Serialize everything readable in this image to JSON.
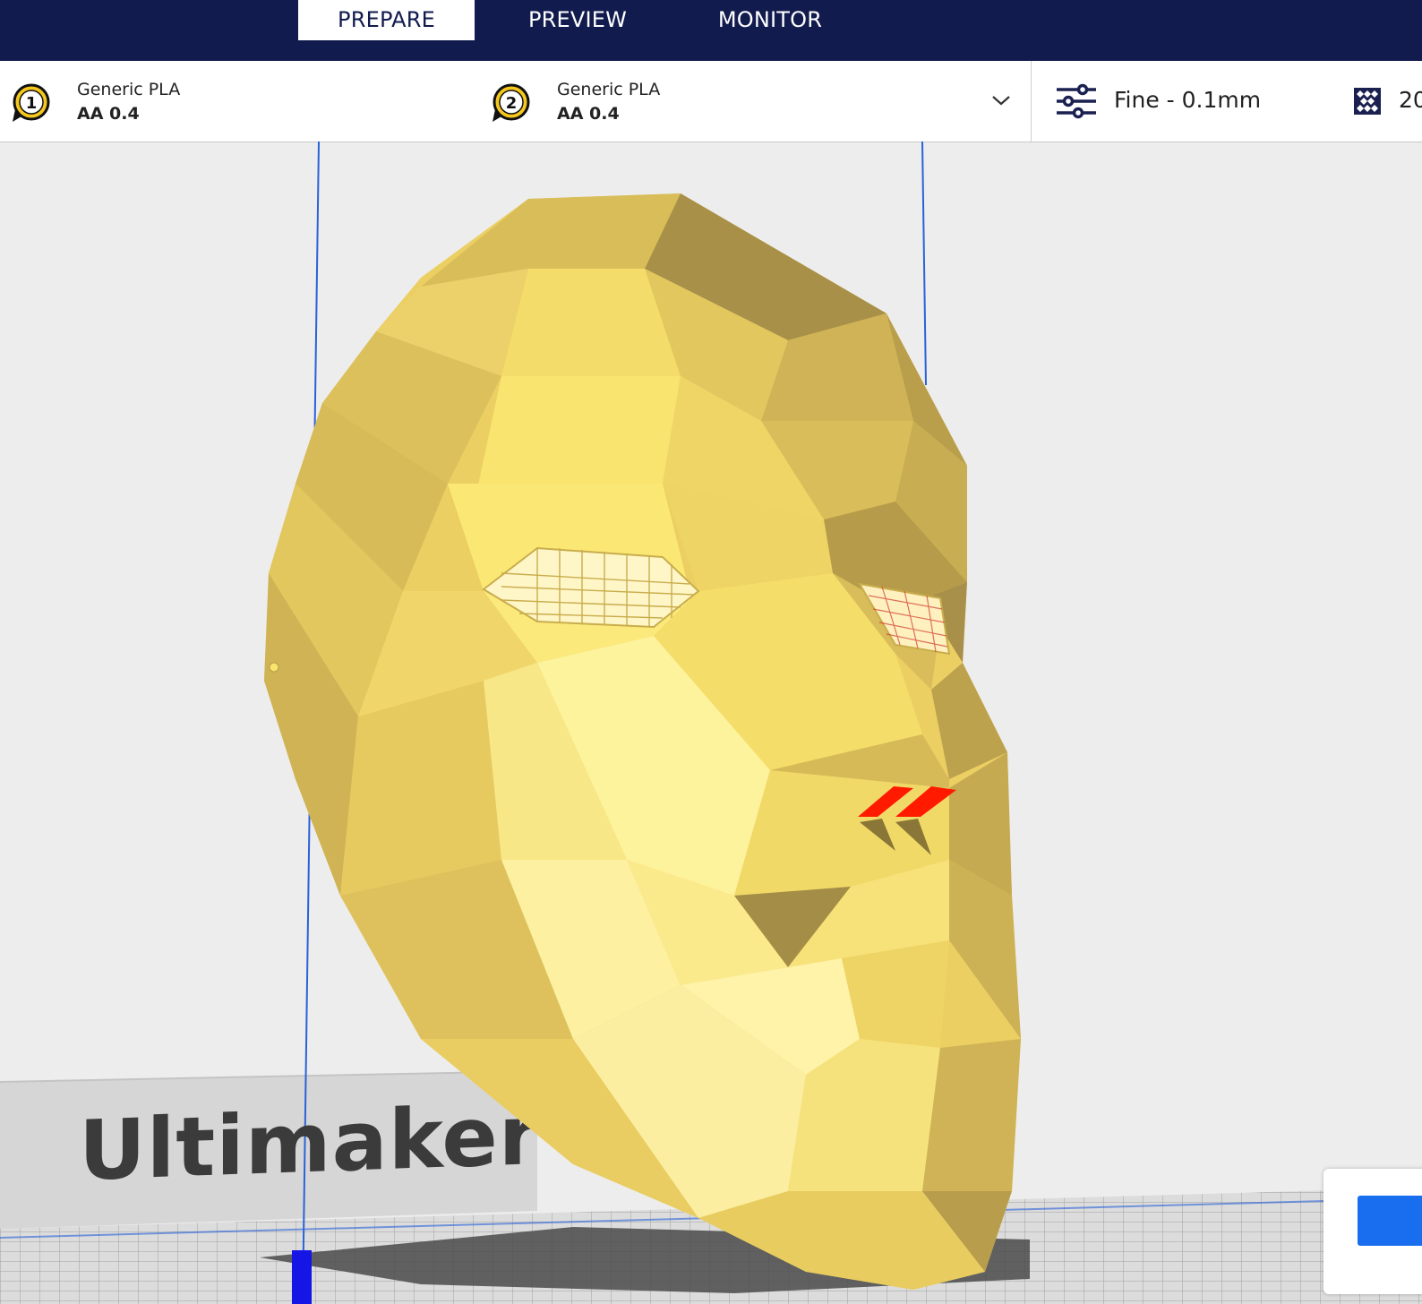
{
  "nav": {
    "tabs": [
      {
        "label": "PREPARE",
        "active": true
      },
      {
        "label": "PREVIEW",
        "active": false
      },
      {
        "label": "MONITOR",
        "active": false
      }
    ]
  },
  "settings": {
    "extruders": [
      {
        "number": "1",
        "material": "Generic PLA",
        "nozzle": "AA 0.4"
      },
      {
        "number": "2",
        "material": "Generic PLA",
        "nozzle": "AA 0.4"
      }
    ],
    "dropdown_icon": "chevron-down-icon",
    "profile": {
      "icon": "sliders-icon",
      "label": "Fine - 0.1mm"
    },
    "infill": {
      "icon": "infill-icon",
      "label": "20"
    }
  },
  "viewport": {
    "brand_text": "Ultimaker",
    "model": "low-poly face mask",
    "model_color": "#f2de6a",
    "support_error_color": "#ff1a00"
  },
  "slice_panel": {
    "button_color": "#196ef0"
  },
  "colors": {
    "topbar": "#121b4e",
    "axis_blue": "#2a62d8"
  }
}
